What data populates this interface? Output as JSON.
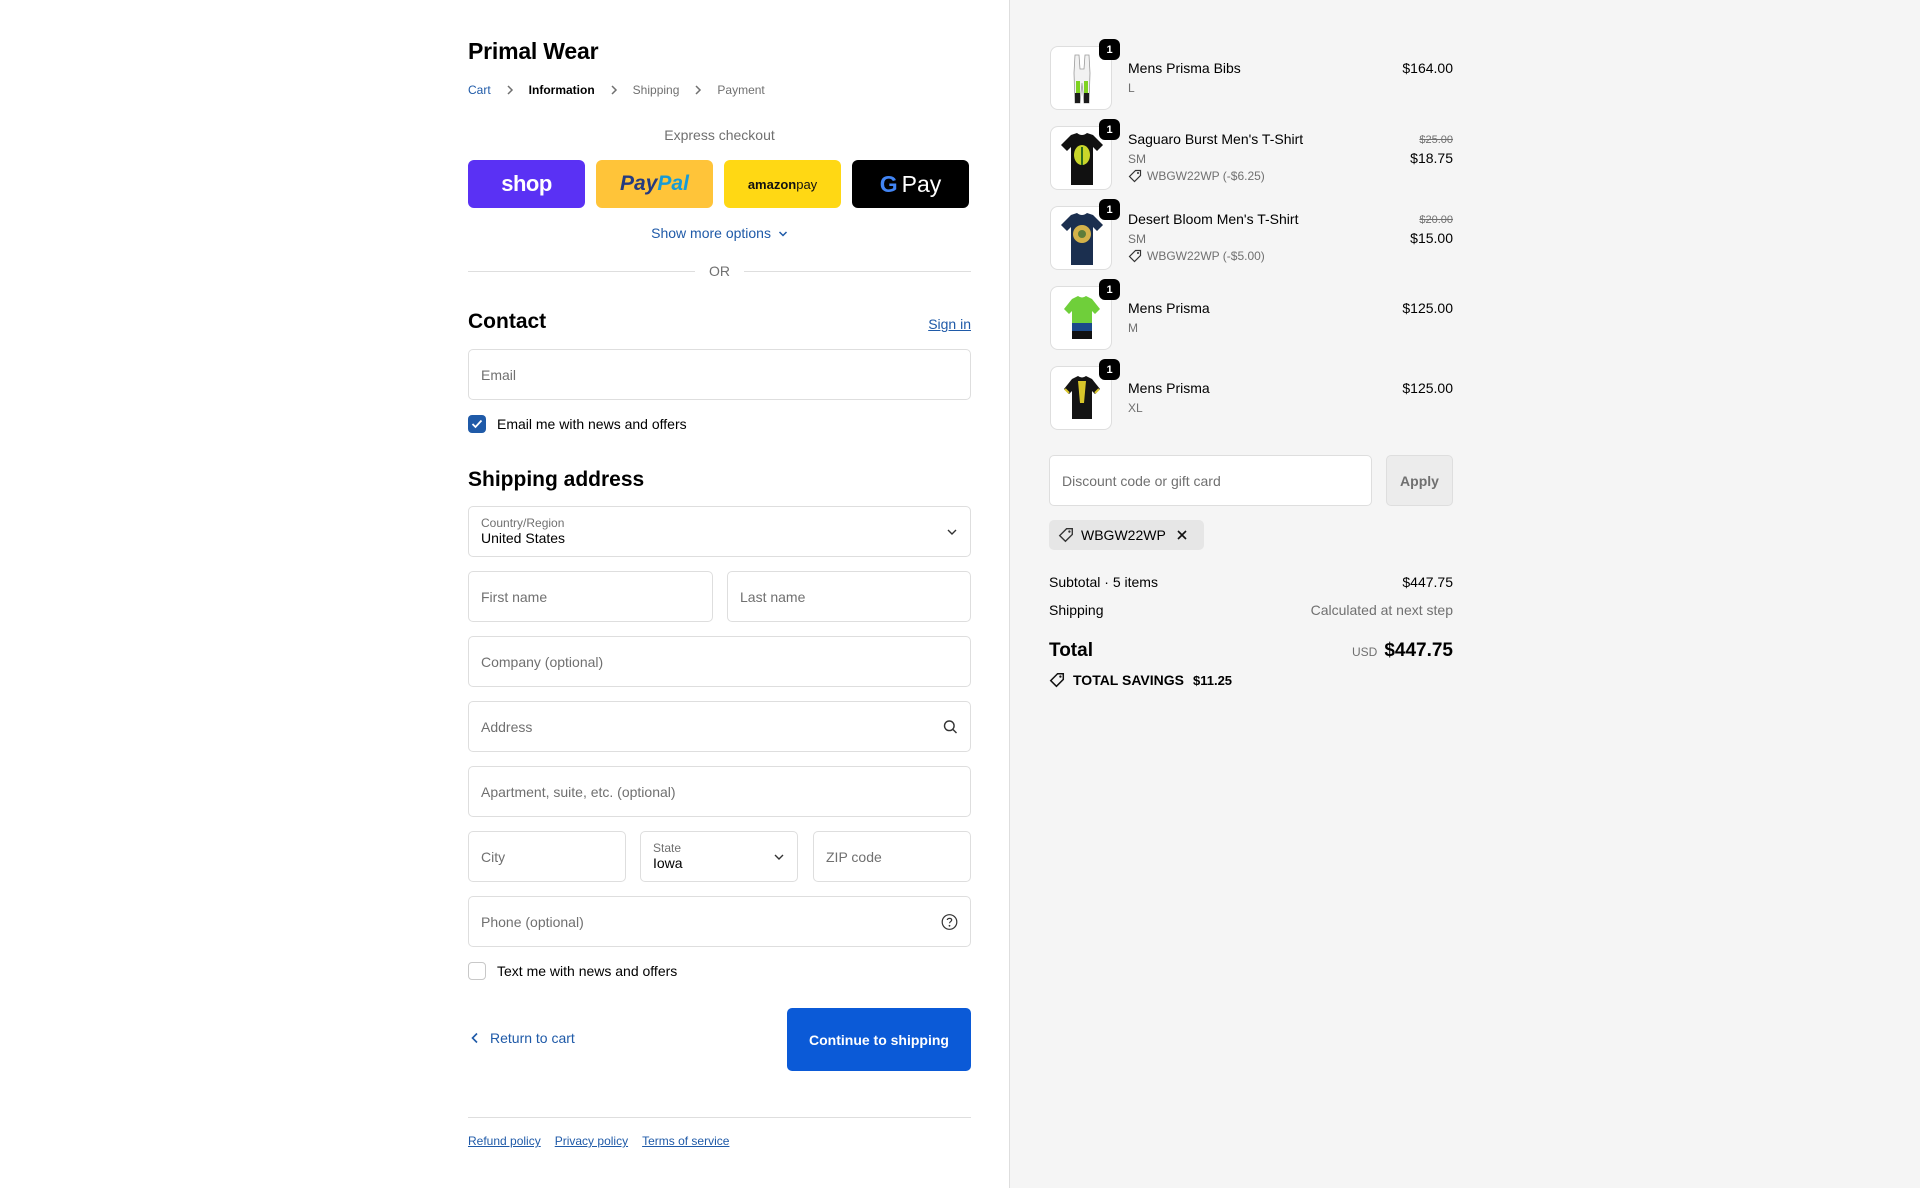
{
  "brand": "Primal Wear",
  "breadcrumb": {
    "cart": "Cart",
    "information": "Information",
    "shipping": "Shipping",
    "payment": "Payment"
  },
  "express": {
    "title": "Express checkout",
    "shop_label": "shop",
    "paypal_label_1": "Pay",
    "paypal_label_2": "Pal",
    "amazon_label_1": "amazon",
    "amazon_label_2": " pay",
    "gpay_label_g": "G",
    "gpay_label": "Pay",
    "more": "Show more options",
    "or": "OR"
  },
  "contact": {
    "heading": "Contact",
    "signin": "Sign in",
    "email_placeholder": "Email",
    "email_news": "Email me with news and offers",
    "email_news_checked": true
  },
  "shipping": {
    "heading": "Shipping address",
    "country_label": "Country/Region",
    "country_value": "United States",
    "first_name": "First name",
    "last_name": "Last name",
    "company": "Company (optional)",
    "address": "Address",
    "apartment": "Apartment, suite, etc. (optional)",
    "city": "City",
    "state_label": "State",
    "state_value": "Iowa",
    "zip": "ZIP code",
    "phone": "Phone (optional)",
    "text_news": "Text me with news and offers",
    "text_news_checked": false
  },
  "actions": {
    "return": "Return to cart",
    "continue": "Continue to shipping"
  },
  "footer": {
    "refund": "Refund policy",
    "privacy": "Privacy policy",
    "terms": "Terms of service"
  },
  "cart_items": [
    {
      "name": "Mens Prisma Bibs",
      "variant": "L",
      "qty": "1",
      "price": "$164.00",
      "orig": "",
      "discount": "",
      "colors": {
        "body": "#f2f2f2",
        "accent": "#7fd321"
      }
    },
    {
      "name": "Saguaro Burst Men's T-Shirt",
      "variant": "SM",
      "qty": "1",
      "price": "$18.75",
      "orig": "$25.00",
      "discount": "WBGW22WP (-$6.25)",
      "colors": {
        "body": "#111111",
        "accent": "#c9d62a"
      }
    },
    {
      "name": "Desert Bloom Men's T-Shirt",
      "variant": "SM",
      "qty": "1",
      "price": "$15.00",
      "orig": "$20.00",
      "discount": "WBGW22WP (-$5.00)",
      "colors": {
        "body": "#1b2f4f",
        "accent": "#d4b24a"
      }
    },
    {
      "name": "Mens Prisma",
      "variant": "M",
      "qty": "1",
      "price": "$125.00",
      "orig": "",
      "discount": "",
      "colors": {
        "body": "#6fcf3a",
        "accent": "#1b4a8a"
      }
    },
    {
      "name": "Mens Prisma",
      "variant": "XL",
      "qty": "1",
      "price": "$125.00",
      "orig": "",
      "discount": "",
      "colors": {
        "body": "#141414",
        "accent": "#d8c52a"
      }
    }
  ],
  "discount": {
    "placeholder": "Discount code or gift card",
    "apply": "Apply",
    "applied_code": "WBGW22WP"
  },
  "summary": {
    "subtotal_label": "Subtotal · 5 items",
    "subtotal_value": "$447.75",
    "shipping_label": "Shipping",
    "shipping_value": "Calculated at next step",
    "total_label": "Total",
    "currency": "USD",
    "total_value": "$447.75",
    "savings_label": "TOTAL SAVINGS",
    "savings_value": "$11.25"
  },
  "colors": {
    "accent": "#1f5aa8",
    "button": "#0b5ad7",
    "shop": "#5a31f4",
    "paypal": "#ffc439",
    "amazon": "#ffd814",
    "sidebar_bg": "#f5f5f5"
  }
}
